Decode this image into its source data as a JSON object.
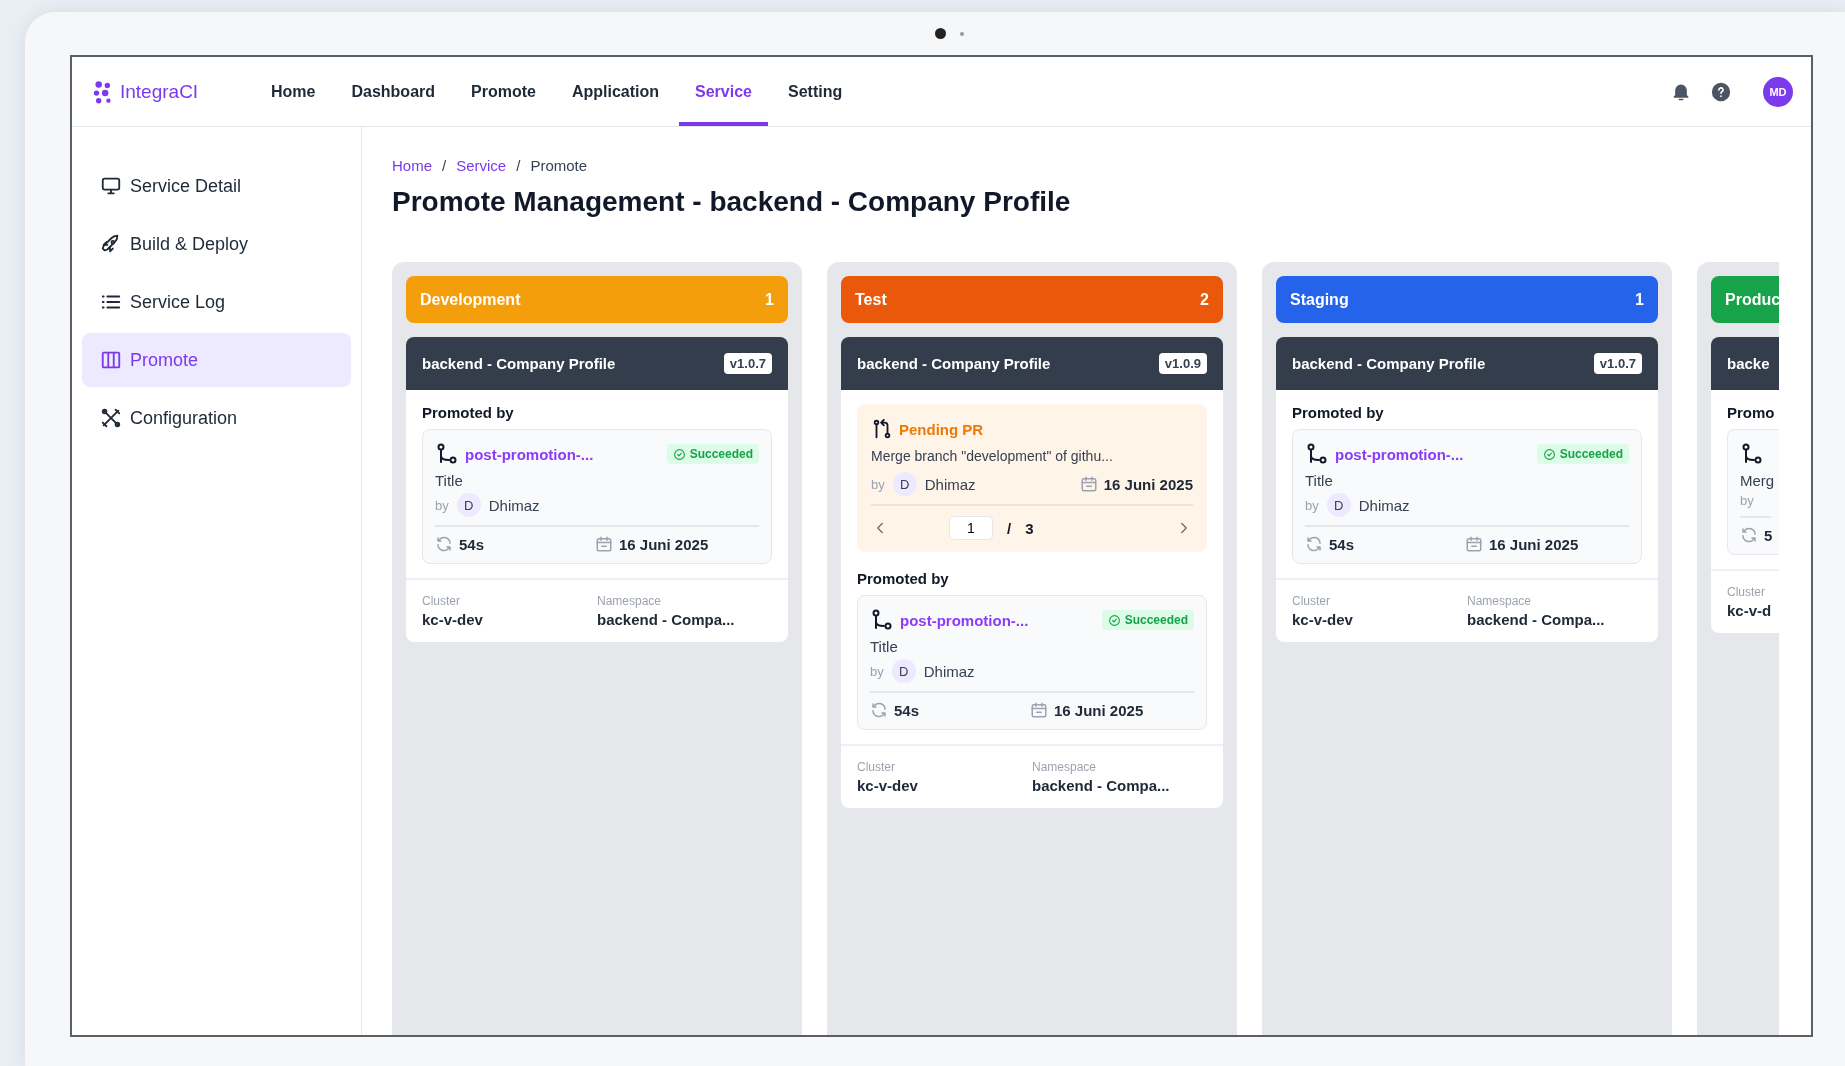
{
  "app": {
    "logo": "IntegraCI"
  },
  "nav": [
    {
      "label": "Home",
      "selected": false
    },
    {
      "label": "Dashboard",
      "selected": false
    },
    {
      "label": "Promote",
      "selected": false
    },
    {
      "label": "Application",
      "selected": false
    },
    {
      "label": "Service",
      "selected": true
    },
    {
      "label": "Setting",
      "selected": false
    }
  ],
  "user": {
    "initials": "MD"
  },
  "sidebar": [
    {
      "label": "Service Detail",
      "kind": "monitor",
      "selected": false
    },
    {
      "label": "Build & Deploy",
      "kind": "rocket",
      "selected": false
    },
    {
      "label": "Service Log",
      "kind": "list",
      "selected": false
    },
    {
      "label": "Promote",
      "kind": "columns",
      "selected": true
    },
    {
      "label": "Configuration",
      "kind": "tools",
      "selected": false
    }
  ],
  "breadcrumb": [
    {
      "label": "Home",
      "link": true
    },
    {
      "label": "Service",
      "link": true
    },
    {
      "label": "Promote",
      "link": false
    }
  ],
  "breadcrumb_separator": "/",
  "page_title": "Promote Management - backend - Company Profile",
  "columns": [
    {
      "kind": "full",
      "name": "Development",
      "count": "1",
      "color": "#f59e0b",
      "card": {
        "title": "backend - Company Profile",
        "version": "v1.0.7",
        "promoted": {
          "label": "Promoted by",
          "pipeline": "post-promotion-...",
          "status": "Succeeded",
          "title": "Title",
          "by_label": "by",
          "avatar": "D",
          "author": "Dhimaz",
          "duration": "54s",
          "date": "16 Juni 2025"
        },
        "footer": {
          "cluster_label": "Cluster",
          "cluster": "kc-v-dev",
          "namespace_label": "Namespace",
          "namespace": "backend - Compa..."
        }
      }
    },
    {
      "kind": "full",
      "name": "Test",
      "count": "2",
      "color": "#ea580c",
      "card": {
        "title": "backend - Company Profile",
        "version": "v1.0.9",
        "pending_pr": {
          "label": "Pending PR",
          "message": "Merge branch \"development\" of githu...",
          "by_label": "by",
          "avatar": "D",
          "author": "Dhimaz",
          "date": "16 Juni 2025",
          "page": "1",
          "separator": "/",
          "total": "3"
        },
        "promoted": {
          "label": "Promoted by",
          "pipeline": "post-promotion-...",
          "status": "Succeeded",
          "title": "Title",
          "by_label": "by",
          "avatar": "D",
          "author": "Dhimaz",
          "duration": "54s",
          "date": "16 Juni 2025"
        },
        "footer": {
          "cluster_label": "Cluster",
          "cluster": "kc-v-dev",
          "namespace_label": "Namespace",
          "namespace": "backend - Compa..."
        }
      }
    },
    {
      "kind": "full",
      "name": "Staging",
      "count": "1",
      "color": "#2563eb",
      "card": {
        "title": "backend - Company Profile",
        "version": "v1.0.7",
        "promoted": {
          "label": "Promoted by",
          "pipeline": "post-promotion-...",
          "status": "Succeeded",
          "title": "Title",
          "by_label": "by",
          "avatar": "D",
          "author": "Dhimaz",
          "duration": "54s",
          "date": "16 Juni 2025"
        },
        "footer": {
          "cluster_label": "Cluster",
          "cluster": "kc-v-dev",
          "namespace_label": "Namespace",
          "namespace": "backend - Compa..."
        }
      }
    },
    {
      "kind": "clipped",
      "name": "Produc",
      "color": "#16a34a",
      "card": {
        "title": "backe",
        "promoted": {
          "label": "Promo",
          "title": "Merg",
          "by_label": "by",
          "duration": "5"
        },
        "footer": {
          "cluster_label": "Cluster",
          "cluster": "kc-v-d"
        }
      }
    }
  ]
}
